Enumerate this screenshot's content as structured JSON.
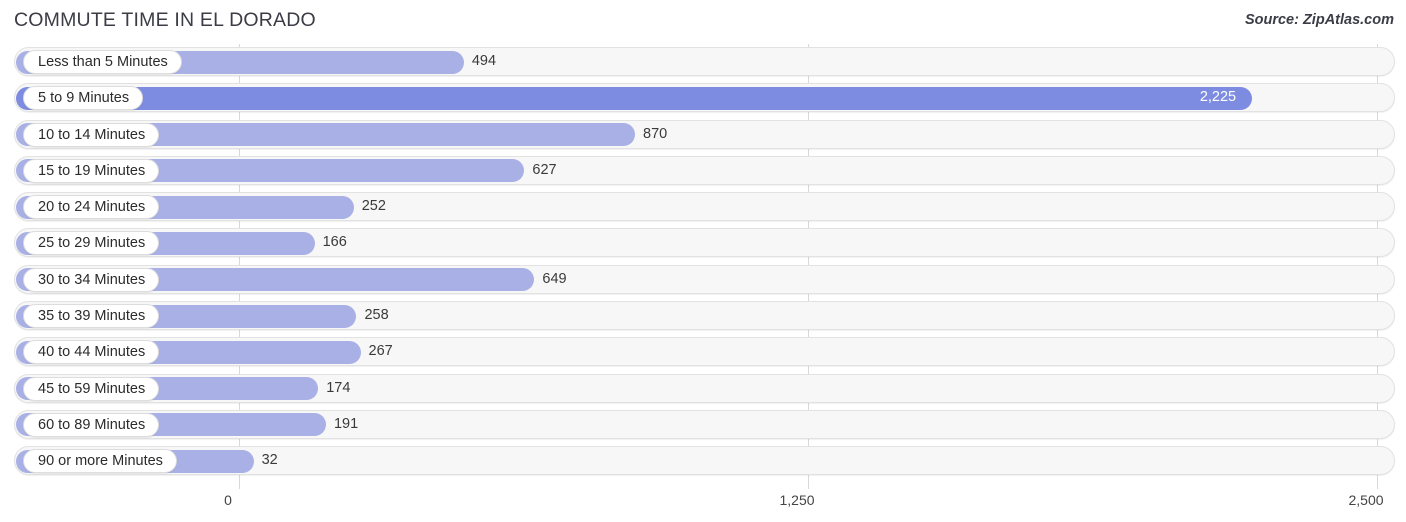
{
  "header": {
    "title": "COMMUTE TIME IN EL DORADO",
    "source": "Source: ZipAtlas.com"
  },
  "colors": {
    "bar": "#a8b0e6",
    "bar_max": "#7d8ce0",
    "track": "#f7f7f7",
    "gridline": "#d8d8d8",
    "text": "#3c3c46"
  },
  "chart_data": {
    "type": "bar",
    "orientation": "horizontal",
    "title": "COMMUTE TIME IN EL DORADO",
    "xlabel": "",
    "ylabel": "",
    "xlim": [
      0,
      2500
    ],
    "grid": true,
    "legend": false,
    "ticks": [
      "0",
      "1,250",
      "2,500"
    ],
    "tick_values": [
      0,
      1250,
      2500
    ],
    "categories": [
      "Less than 5 Minutes",
      "5 to 9 Minutes",
      "10 to 14 Minutes",
      "15 to 19 Minutes",
      "20 to 24 Minutes",
      "25 to 29 Minutes",
      "30 to 34 Minutes",
      "35 to 39 Minutes",
      "40 to 44 Minutes",
      "45 to 59 Minutes",
      "60 to 89 Minutes",
      "90 or more Minutes"
    ],
    "values": [
      494,
      2225,
      870,
      627,
      252,
      166,
      649,
      258,
      267,
      174,
      191,
      32
    ],
    "value_labels": [
      "494",
      "2,225",
      "870",
      "627",
      "252",
      "166",
      "649",
      "258",
      "267",
      "174",
      "191",
      "32"
    ],
    "max_index": 1
  }
}
